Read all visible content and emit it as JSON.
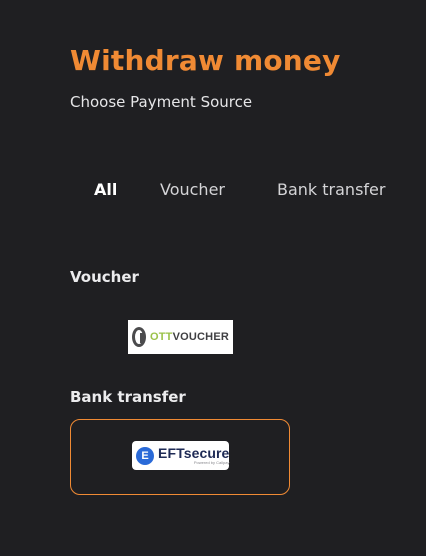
{
  "page": {
    "title": "Withdraw money",
    "subtitle": "Choose Payment Source"
  },
  "tabs": [
    {
      "label": "All",
      "active": true
    },
    {
      "label": "Voucher",
      "active": false
    },
    {
      "label": "Bank transfer",
      "active": false
    }
  ],
  "sections": {
    "voucher": {
      "heading": "Voucher",
      "logo": {
        "name": "OTT Voucher",
        "text_a": "OTT",
        "text_b": "VOUCHER"
      }
    },
    "bank_transfer": {
      "heading": "Bank transfer",
      "logo": {
        "name": "EFTsecure",
        "mark": "E",
        "text": "EFTsecure",
        "sub": "Powered by Callpay"
      }
    }
  },
  "colors": {
    "background": "#1f1f22",
    "accent": "#f08a34",
    "text": "#e8e8ea"
  },
  "icons": {
    "ott_logo": "ott-voucher-logo-icon",
    "eft_logo": "eftsecure-logo-icon"
  }
}
